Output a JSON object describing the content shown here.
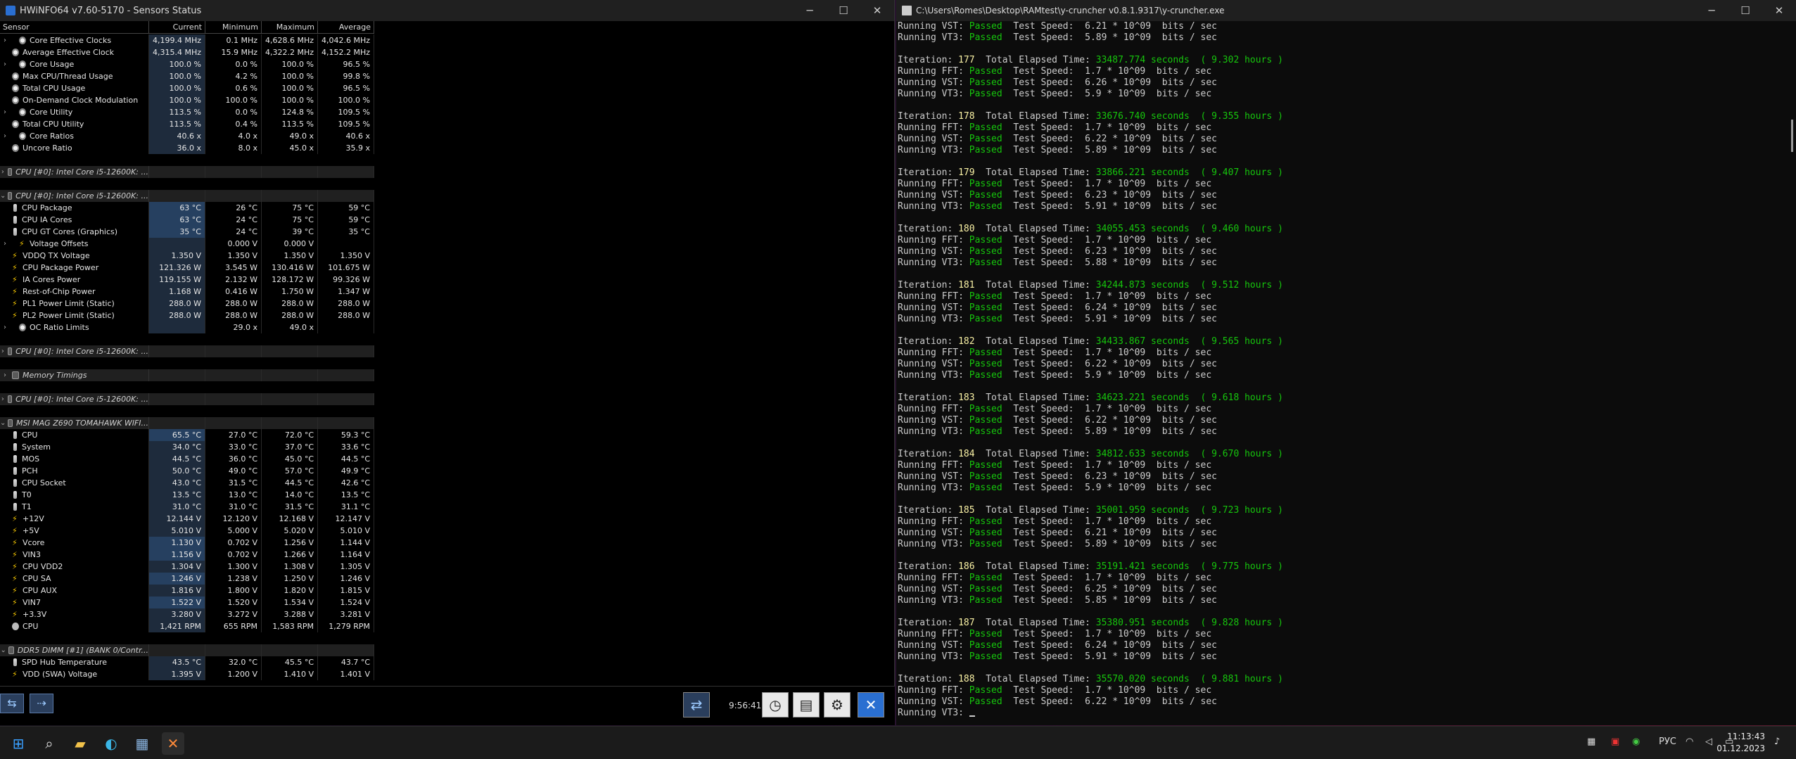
{
  "hwinfo": {
    "title": "HWiNFO64 v7.60-5170 - Sensors Status",
    "columns": [
      "Sensor",
      "Current",
      "Minimum",
      "Maximum",
      "Average"
    ],
    "rows": [
      {
        "t": "s",
        "ind": 1,
        "exp": ">",
        "icon": "clock",
        "name": "Core Effective Clocks",
        "v": [
          "4,199.4 MHz",
          "0.1 MHz",
          "4,628.6 MHz",
          "4,042.6 MHz"
        ]
      },
      {
        "t": "s",
        "ind": 0,
        "icon": "clock",
        "name": "Average Effective Clock",
        "v": [
          "4,315.4 MHz",
          "15.9 MHz",
          "4,322.2 MHz",
          "4,152.2 MHz"
        ]
      },
      {
        "t": "s",
        "ind": 1,
        "exp": ">",
        "icon": "clock",
        "name": "Core Usage",
        "v": [
          "100.0 %",
          "0.0 %",
          "100.0 %",
          "96.5 %"
        ]
      },
      {
        "t": "s",
        "ind": 0,
        "icon": "clock",
        "name": "Max CPU/Thread Usage",
        "v": [
          "100.0 %",
          "4.2 %",
          "100.0 %",
          "99.8 %"
        ]
      },
      {
        "t": "s",
        "ind": 0,
        "icon": "clock",
        "name": "Total CPU Usage",
        "v": [
          "100.0 %",
          "0.6 %",
          "100.0 %",
          "96.5 %"
        ]
      },
      {
        "t": "s",
        "ind": 0,
        "icon": "clock",
        "name": "On-Demand Clock Modulation",
        "v": [
          "100.0 %",
          "100.0 %",
          "100.0 %",
          "100.0 %"
        ]
      },
      {
        "t": "s",
        "ind": 1,
        "exp": ">",
        "icon": "clock",
        "name": "Core Utility",
        "v": [
          "113.5 %",
          "0.0 %",
          "124.8 %",
          "109.5 %"
        ]
      },
      {
        "t": "s",
        "ind": 0,
        "icon": "clock",
        "name": "Total CPU Utility",
        "v": [
          "113.5 %",
          "0.4 %",
          "113.5 %",
          "109.5 %"
        ]
      },
      {
        "t": "s",
        "ind": 1,
        "exp": ">",
        "icon": "clock",
        "name": "Core Ratios",
        "v": [
          "40.6 x",
          "4.0 x",
          "49.0 x",
          "40.6 x"
        ]
      },
      {
        "t": "s",
        "ind": 0,
        "icon": "clock",
        "name": "Uncore Ratio",
        "v": [
          "36.0 x",
          "8.0 x",
          "45.0 x",
          "35.9 x"
        ]
      },
      {
        "t": "b"
      },
      {
        "t": "g",
        "exp": ">",
        "name": "CPU [#0]: Intel Core i5-12600K: ..."
      },
      {
        "t": "b"
      },
      {
        "t": "g",
        "exp": "v",
        "name": "CPU [#0]: Intel Core i5-12600K: ..."
      },
      {
        "t": "s",
        "ind": 0,
        "icon": "therm",
        "name": "CPU Package",
        "v": [
          "63 °C",
          "26 °C",
          "75 °C",
          "59 °C"
        ],
        "hl": true
      },
      {
        "t": "s",
        "ind": 0,
        "icon": "therm",
        "name": "CPU IA Cores",
        "v": [
          "63 °C",
          "24 °C",
          "75 °C",
          "59 °C"
        ],
        "hl": true
      },
      {
        "t": "s",
        "ind": 0,
        "icon": "therm",
        "name": "CPU GT Cores (Graphics)",
        "v": [
          "35 °C",
          "24 °C",
          "39 °C",
          "35 °C"
        ],
        "hl": true
      },
      {
        "t": "s",
        "ind": 1,
        "exp": ">",
        "icon": "bolt",
        "name": "Voltage Offsets",
        "v": [
          "",
          "0.000 V",
          "0.000 V",
          ""
        ]
      },
      {
        "t": "s",
        "ind": 0,
        "icon": "bolt",
        "name": "VDDQ TX Voltage",
        "v": [
          "1.350 V",
          "1.350 V",
          "1.350 V",
          "1.350 V"
        ]
      },
      {
        "t": "s",
        "ind": 0,
        "icon": "bolt",
        "name": "CPU Package Power",
        "v": [
          "121.326 W",
          "3.545 W",
          "130.416 W",
          "101.675 W"
        ]
      },
      {
        "t": "s",
        "ind": 0,
        "icon": "bolt",
        "name": "IA Cores Power",
        "v": [
          "119.155 W",
          "2.132 W",
          "128.172 W",
          "99.326 W"
        ]
      },
      {
        "t": "s",
        "ind": 0,
        "icon": "bolt",
        "name": "Rest-of-Chip Power",
        "v": [
          "1.168 W",
          "0.416 W",
          "1.750 W",
          "1.347 W"
        ]
      },
      {
        "t": "s",
        "ind": 0,
        "icon": "bolt",
        "name": "PL1 Power Limit (Static)",
        "v": [
          "288.0 W",
          "288.0 W",
          "288.0 W",
          "288.0 W"
        ]
      },
      {
        "t": "s",
        "ind": 0,
        "icon": "bolt",
        "name": "PL2 Power Limit (Static)",
        "v": [
          "288.0 W",
          "288.0 W",
          "288.0 W",
          "288.0 W"
        ]
      },
      {
        "t": "s",
        "ind": 1,
        "exp": ">",
        "icon": "clock",
        "name": "OC Ratio Limits",
        "v": [
          "",
          "29.0 x",
          "49.0 x",
          ""
        ]
      },
      {
        "t": "b"
      },
      {
        "t": "g",
        "exp": ">",
        "name": "CPU [#0]: Intel Core i5-12600K: ..."
      },
      {
        "t": "b"
      },
      {
        "t": "g",
        "exp": ">",
        "name": "Memory Timings"
      },
      {
        "t": "b"
      },
      {
        "t": "g",
        "exp": ">",
        "name": "CPU [#0]: Intel Core i5-12600K: ..."
      },
      {
        "t": "b"
      },
      {
        "t": "g",
        "exp": "v",
        "name": "MSI MAG Z690 TOMAHAWK WIFI..."
      },
      {
        "t": "s",
        "ind": 0,
        "icon": "therm",
        "name": "CPU",
        "v": [
          "65.5 °C",
          "27.0 °C",
          "72.0 °C",
          "59.3 °C"
        ],
        "hl": true
      },
      {
        "t": "s",
        "ind": 0,
        "icon": "therm",
        "name": "System",
        "v": [
          "34.0 °C",
          "33.0 °C",
          "37.0 °C",
          "33.6 °C"
        ]
      },
      {
        "t": "s",
        "ind": 0,
        "icon": "therm",
        "name": "MOS",
        "v": [
          "44.5 °C",
          "36.0 °C",
          "45.0 °C",
          "44.5 °C"
        ]
      },
      {
        "t": "s",
        "ind": 0,
        "icon": "therm",
        "name": "PCH",
        "v": [
          "50.0 °C",
          "49.0 °C",
          "57.0 °C",
          "49.9 °C"
        ]
      },
      {
        "t": "s",
        "ind": 0,
        "icon": "therm",
        "name": "CPU Socket",
        "v": [
          "43.0 °C",
          "31.5 °C",
          "44.5 °C",
          "42.6 °C"
        ]
      },
      {
        "t": "s",
        "ind": 0,
        "icon": "therm",
        "name": "T0",
        "v": [
          "13.5 °C",
          "13.0 °C",
          "14.0 °C",
          "13.5 °C"
        ]
      },
      {
        "t": "s",
        "ind": 0,
        "icon": "therm",
        "name": "T1",
        "v": [
          "31.0 °C",
          "31.0 °C",
          "31.5 °C",
          "31.1 °C"
        ]
      },
      {
        "t": "s",
        "ind": 0,
        "icon": "bolt",
        "name": "+12V",
        "v": [
          "12.144 V",
          "12.120 V",
          "12.168 V",
          "12.147 V"
        ]
      },
      {
        "t": "s",
        "ind": 0,
        "icon": "bolt",
        "name": "+5V",
        "v": [
          "5.010 V",
          "5.000 V",
          "5.020 V",
          "5.010 V"
        ]
      },
      {
        "t": "s",
        "ind": 0,
        "icon": "bolt",
        "name": "Vcore",
        "v": [
          "1.130 V",
          "0.702 V",
          "1.256 V",
          "1.144 V"
        ],
        "hl": true
      },
      {
        "t": "s",
        "ind": 0,
        "icon": "bolt",
        "name": "VIN3",
        "v": [
          "1.156 V",
          "0.702 V",
          "1.266 V",
          "1.164 V"
        ],
        "hl": true
      },
      {
        "t": "s",
        "ind": 0,
        "icon": "bolt",
        "name": "CPU VDD2",
        "v": [
          "1.304 V",
          "1.300 V",
          "1.308 V",
          "1.305 V"
        ]
      },
      {
        "t": "s",
        "ind": 0,
        "icon": "bolt",
        "name": "CPU SA",
        "v": [
          "1.246 V",
          "1.238 V",
          "1.250 V",
          "1.246 V"
        ],
        "hl": true
      },
      {
        "t": "s",
        "ind": 0,
        "icon": "bolt",
        "name": "CPU AUX",
        "v": [
          "1.816 V",
          "1.800 V",
          "1.820 V",
          "1.815 V"
        ]
      },
      {
        "t": "s",
        "ind": 0,
        "icon": "bolt",
        "name": "VIN7",
        "v": [
          "1.522 V",
          "1.520 V",
          "1.534 V",
          "1.524 V"
        ],
        "hl": true
      },
      {
        "t": "s",
        "ind": 0,
        "icon": "bolt",
        "name": "+3.3V",
        "v": [
          "3.280 V",
          "3.272 V",
          "3.288 V",
          "3.281 V"
        ]
      },
      {
        "t": "s",
        "ind": 0,
        "icon": "fan",
        "name": "CPU",
        "v": [
          "1,421 RPM",
          "655 RPM",
          "1,583 RPM",
          "1,279 RPM"
        ]
      },
      {
        "t": "b"
      },
      {
        "t": "g",
        "exp": "v",
        "name": "DDR5 DIMM [#1] (BANK 0/Contr..."
      },
      {
        "t": "s",
        "ind": 0,
        "icon": "therm",
        "name": "SPD Hub Temperature",
        "v": [
          "43.5 °C",
          "32.0 °C",
          "45.5 °C",
          "43.7 °C"
        ]
      },
      {
        "t": "s",
        "ind": 0,
        "icon": "bolt",
        "name": "VDD (SWA) Voltage",
        "v": [
          "1.395 V",
          "1.200 V",
          "1.410 V",
          "1.401 V"
        ]
      }
    ],
    "timer": "9:56:41"
  },
  "console": {
    "title": "C:\\Users\\Romes\\Desktop\\RAMtest\\y-cruncher v0.8.1.9317\\y-cruncher.exe",
    "lead": [
      {
        "test": "VST",
        "speed": "6.21"
      },
      {
        "test": "VT3",
        "speed": "5.89"
      }
    ],
    "iterations": [
      {
        "n": "177",
        "elapsed": "33487.774",
        "hours": "9.302",
        "fft": "1.7",
        "vst": "6.26",
        "vt3": "5.9"
      },
      {
        "n": "178",
        "elapsed": "33676.740",
        "hours": "9.355",
        "fft": "1.7",
        "vst": "6.22",
        "vt3": "5.89"
      },
      {
        "n": "179",
        "elapsed": "33866.221",
        "hours": "9.407",
        "fft": "1.7",
        "vst": "6.23",
        "vt3": "5.91"
      },
      {
        "n": "180",
        "elapsed": "34055.453",
        "hours": "9.460",
        "fft": "1.7",
        "vst": "6.23",
        "vt3": "5.88"
      },
      {
        "n": "181",
        "elapsed": "34244.873",
        "hours": "9.512",
        "fft": "1.7",
        "vst": "6.24",
        "vt3": "5.91"
      },
      {
        "n": "182",
        "elapsed": "34433.867",
        "hours": "9.565",
        "fft": "1.7",
        "vst": "6.22",
        "vt3": "5.9"
      },
      {
        "n": "183",
        "elapsed": "34623.221",
        "hours": "9.618",
        "fft": "1.7",
        "vst": "6.22",
        "vt3": "5.89"
      },
      {
        "n": "184",
        "elapsed": "34812.633",
        "hours": "9.670",
        "fft": "1.7",
        "vst": "6.23",
        "vt3": "5.9"
      },
      {
        "n": "185",
        "elapsed": "35001.959",
        "hours": "9.723",
        "fft": "1.7",
        "vst": "6.21",
        "vt3": "5.89"
      },
      {
        "n": "186",
        "elapsed": "35191.421",
        "hours": "9.775",
        "fft": "1.7",
        "vst": "6.25",
        "vt3": "5.85"
      },
      {
        "n": "187",
        "elapsed": "35380.951",
        "hours": "9.828",
        "fft": "1.7",
        "vst": "6.24",
        "vt3": "5.91"
      },
      {
        "n": "188",
        "elapsed": "35570.020",
        "hours": "9.881",
        "fft": "1.7",
        "vst": "6.22",
        "vt3": ""
      }
    ],
    "tail": "Running VT3: "
  },
  "taskbar": {
    "lang": "РУС",
    "time": "11:13:43",
    "date": "01.12.2023"
  }
}
